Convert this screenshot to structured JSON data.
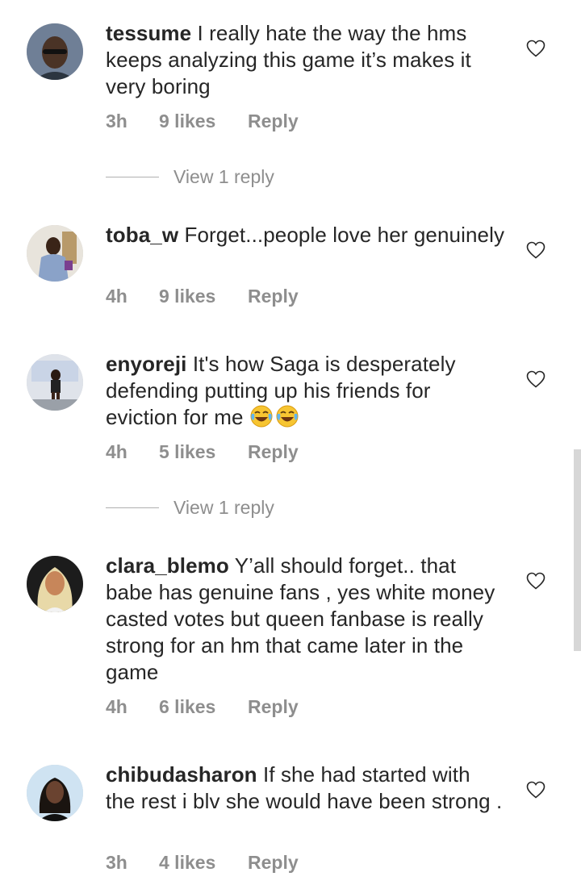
{
  "comments": [
    {
      "username": "tessume",
      "text": "I really hate the way the hms keeps analyzing this game it’s makes it very boring",
      "time": "3h",
      "likes": "9 likes",
      "reply": "Reply",
      "view_replies": "View 1 reply"
    },
    {
      "username": "toba_w",
      "text": "Forget...people love her genuinely",
      "time": "4h",
      "likes": "9 likes",
      "reply": "Reply"
    },
    {
      "username": "enyoreji",
      "text": "It's how Saga is desperately defending putting up his friends for eviction for me",
      "emoji": "😂😂",
      "emoji_icon": "face-with-tears-of-joy-icon",
      "time": "4h",
      "likes": "5 likes",
      "reply": "Reply",
      "view_replies": "View 1 reply"
    },
    {
      "username": "clara_blemo",
      "text": "Y’all should forget.. that babe has genuine fans , yes white money casted votes but queen fanbase is really strong for an hm that came later in the game",
      "time": "4h",
      "likes": "6 likes",
      "reply": "Reply"
    },
    {
      "username": "chibudasharon",
      "text": "If she had started with the rest i blv she would have been strong .",
      "time": "3h",
      "likes": "4 likes",
      "reply": "Reply"
    }
  ],
  "icons": {
    "like": "heart-outline-icon"
  },
  "colors": {
    "text": "#262626",
    "secondary": "#8e8e8e"
  }
}
